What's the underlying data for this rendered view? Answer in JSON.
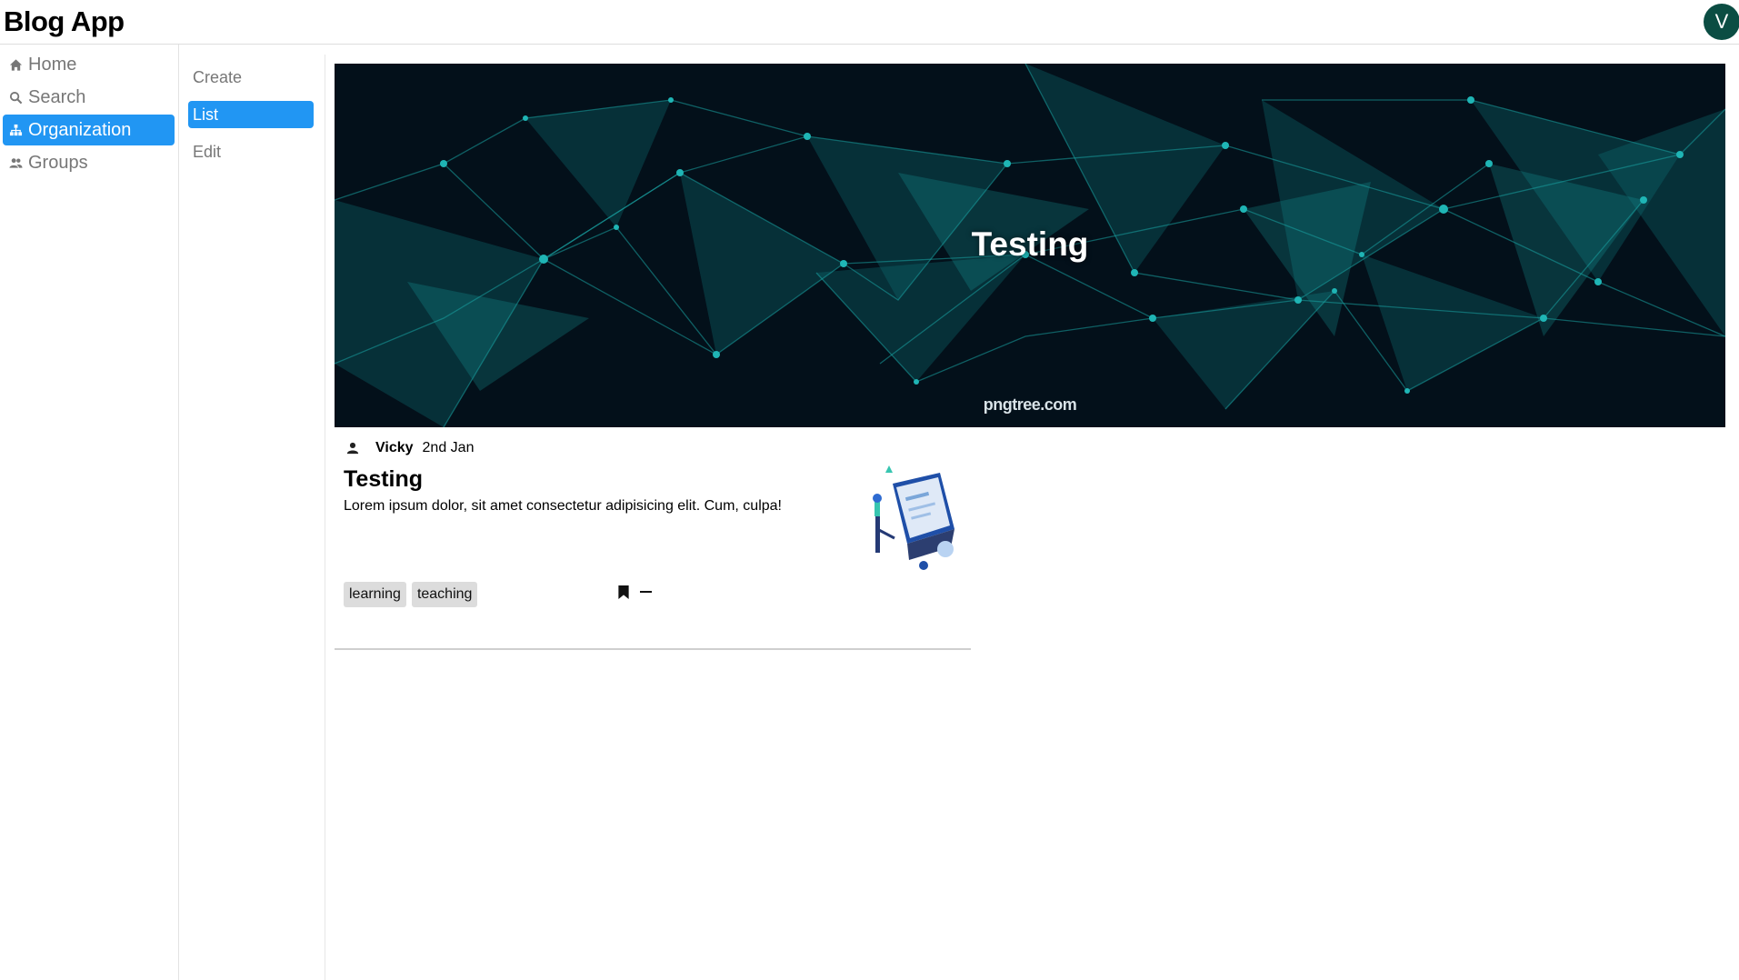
{
  "header": {
    "title": "Blog App",
    "avatar_initial": "V"
  },
  "sidebar": {
    "items": [
      {
        "label": "Home",
        "icon": "home-icon",
        "active": false
      },
      {
        "label": "Search",
        "icon": "search-icon",
        "active": false
      },
      {
        "label": "Organization",
        "icon": "sitemap-icon",
        "active": true
      },
      {
        "label": "Groups",
        "icon": "users-icon",
        "active": false
      }
    ]
  },
  "subnav": {
    "items": [
      {
        "label": "Create",
        "active": false
      },
      {
        "label": "List",
        "active": true
      },
      {
        "label": "Edit",
        "active": false
      }
    ]
  },
  "banner": {
    "title": "Testing",
    "watermark": "pngtree.com"
  },
  "post": {
    "author": "Vicky",
    "date": "2nd Jan",
    "title": "Testing",
    "excerpt": "Lorem ipsum dolor, sit amet consectetur adipisicing elit. Cum, culpa!",
    "tags": [
      "learning",
      "teaching"
    ]
  },
  "colors": {
    "accent": "#2196f3",
    "avatar": "#0b4d43",
    "banner_bg": "#03101a",
    "network": "#1aa3a3"
  }
}
